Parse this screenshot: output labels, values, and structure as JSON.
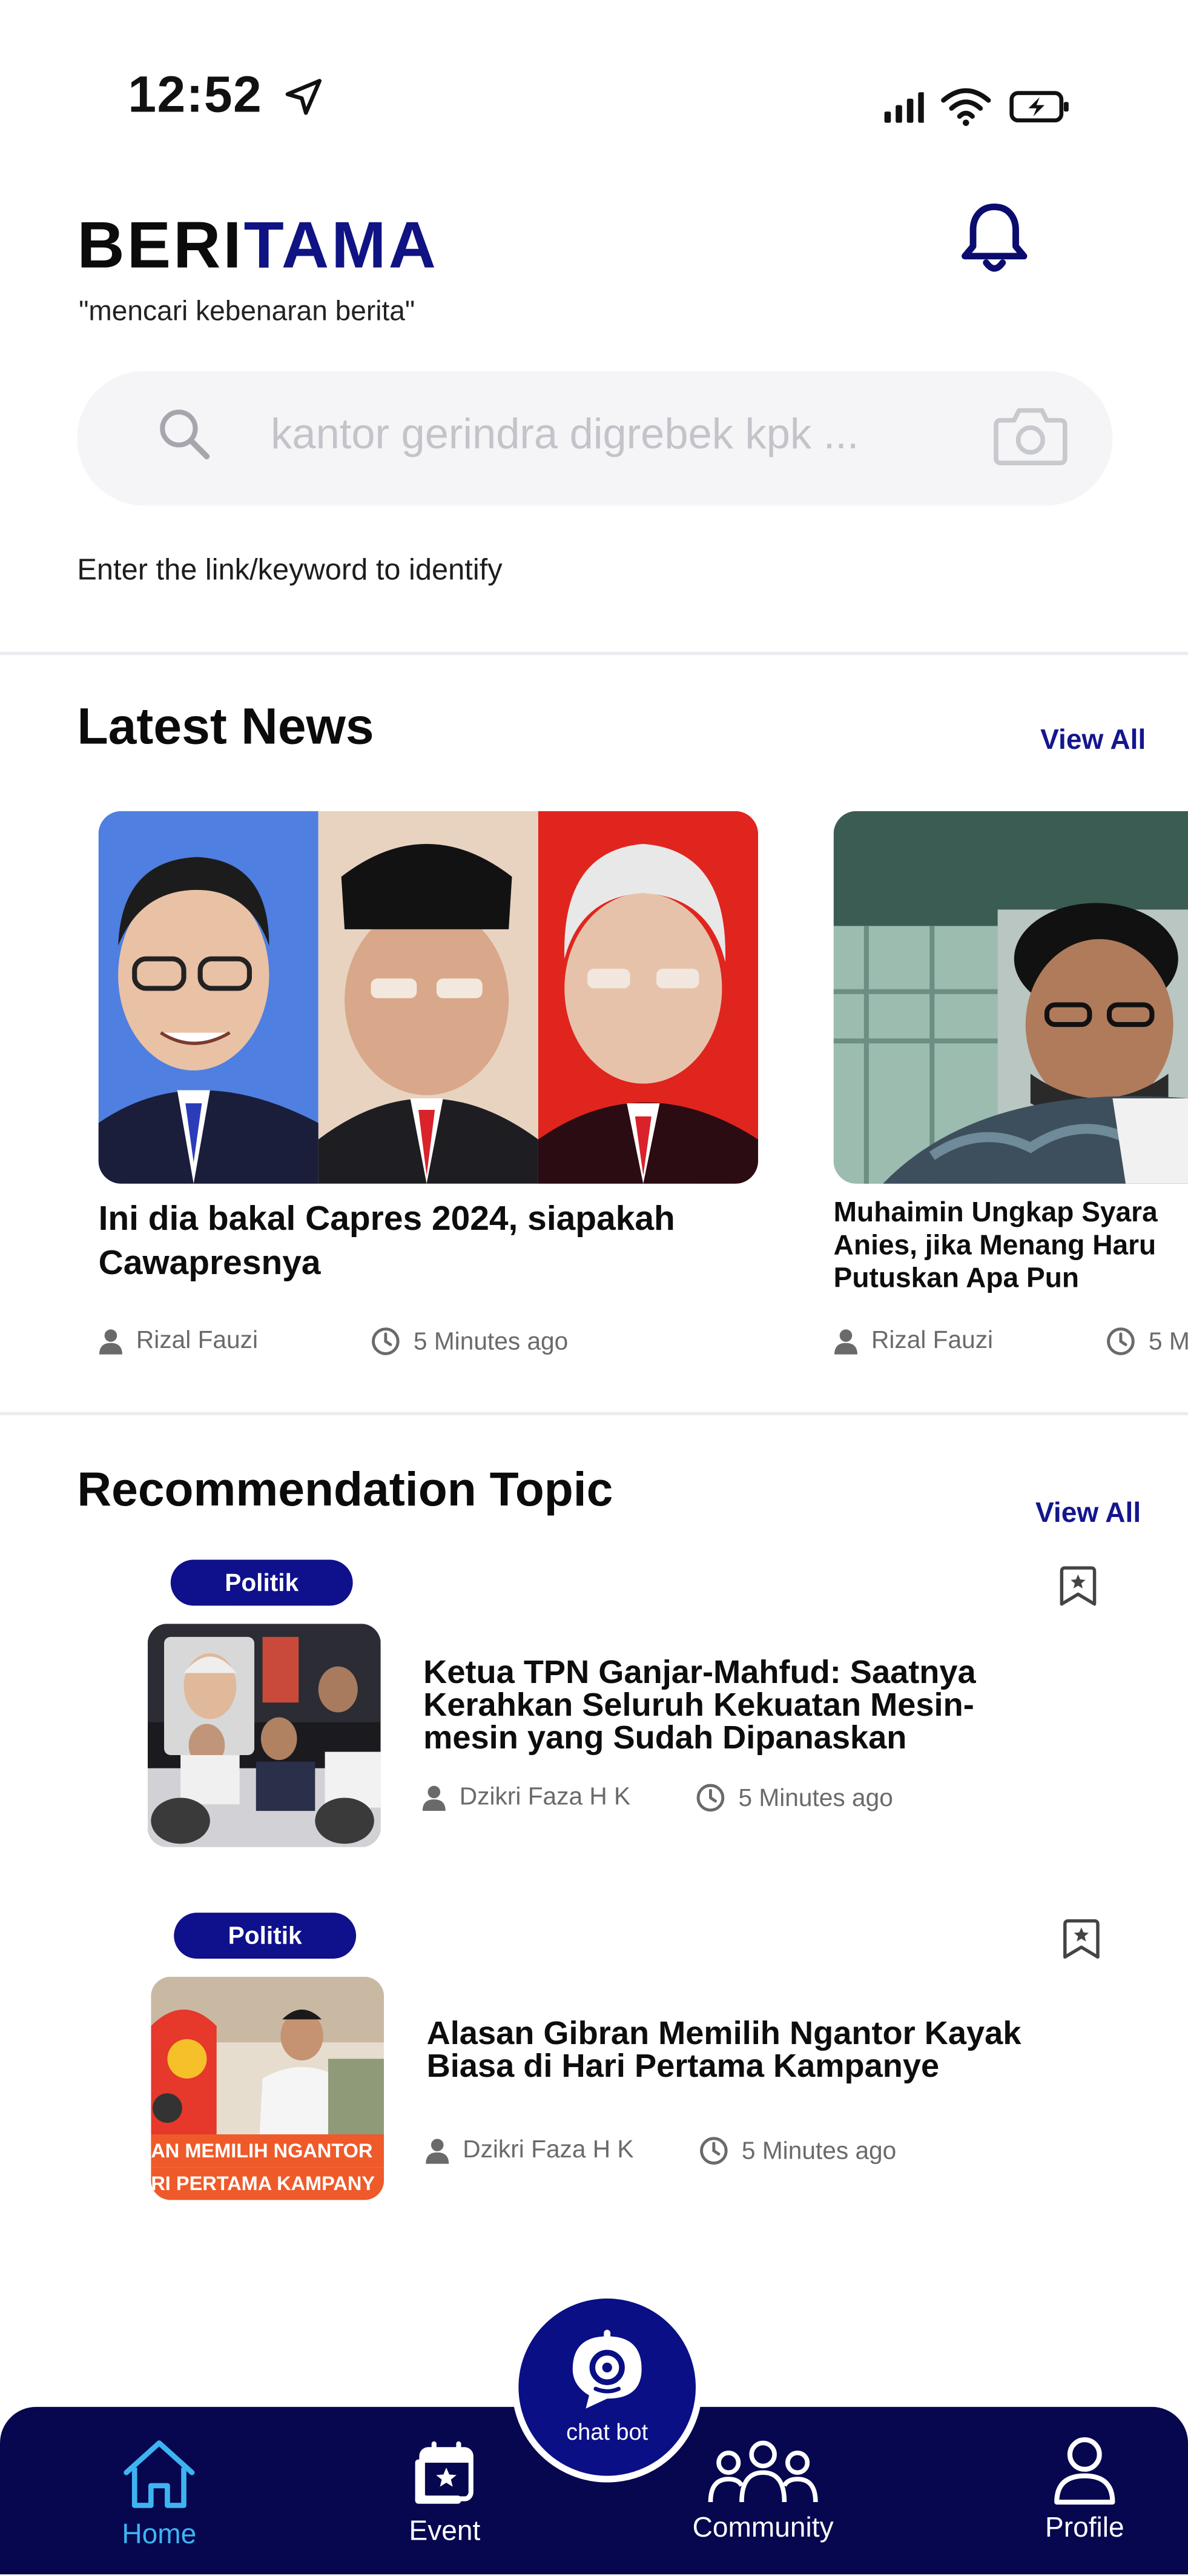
{
  "status_bar": {
    "time": "12:52"
  },
  "header": {
    "brand_part1": "BERI",
    "brand_part2": "TAMA",
    "tagline": "\"mencari kebenaran berita\""
  },
  "search": {
    "placeholder": "kantor gerindra digrebek kpk ...",
    "hint": "Enter the link/keyword to identify"
  },
  "latest_news": {
    "title": "Latest News",
    "view_all": "View All",
    "cards": [
      {
        "title": "Ini dia bakal Capres 2024, siapakah Cawapresnya",
        "author": "Rizal Fauzi",
        "time": "5 Minutes ago"
      },
      {
        "title_lines": [
          "Muhaimin Ungkap Syara",
          "Anies, jika Menang Haru",
          "Putuskan Apa Pun"
        ],
        "author": "Rizal Fauzi",
        "time": "5 M"
      }
    ]
  },
  "recommendation": {
    "title": "Recommendation Topic",
    "view_all": "View All",
    "items": [
      {
        "tag": "Politik",
        "title_lines": [
          "Ketua TPN Ganjar-Mahfud: Saatnya",
          "Kerahkan Seluruh Kekuatan Mesin-",
          "mesin yang Sudah Dipanaskan"
        ],
        "author": "Dzikri Faza H K",
        "time": "5 Minutes ago"
      },
      {
        "tag": "Politik",
        "title_lines": [
          "Alasan Gibran Memilih Ngantor Kayak",
          "Biasa di Hari Pertama Kampanye"
        ],
        "author": "Dzikri Faza H K",
        "time": "5 Minutes ago",
        "image_caption": [
          "AN MEMILIH NGANTOR",
          "RI PERTAMA KAMPANY"
        ]
      }
    ]
  },
  "nav": {
    "items": [
      {
        "label": "Home",
        "icon": "home-icon",
        "active": true
      },
      {
        "label": "Event",
        "icon": "calendar-icon",
        "active": false
      },
      {
        "label": "Community",
        "icon": "community-icon",
        "active": false
      },
      {
        "label": "Profile",
        "icon": "profile-icon",
        "active": false
      }
    ],
    "chatbot_label": "chat bot"
  },
  "colors": {
    "brand_blue": "#101383",
    "tag_blue": "#0e108c",
    "nav_bg": "#06074f",
    "nav_active": "#3db4f0",
    "search_bg": "#f5f5f7"
  }
}
